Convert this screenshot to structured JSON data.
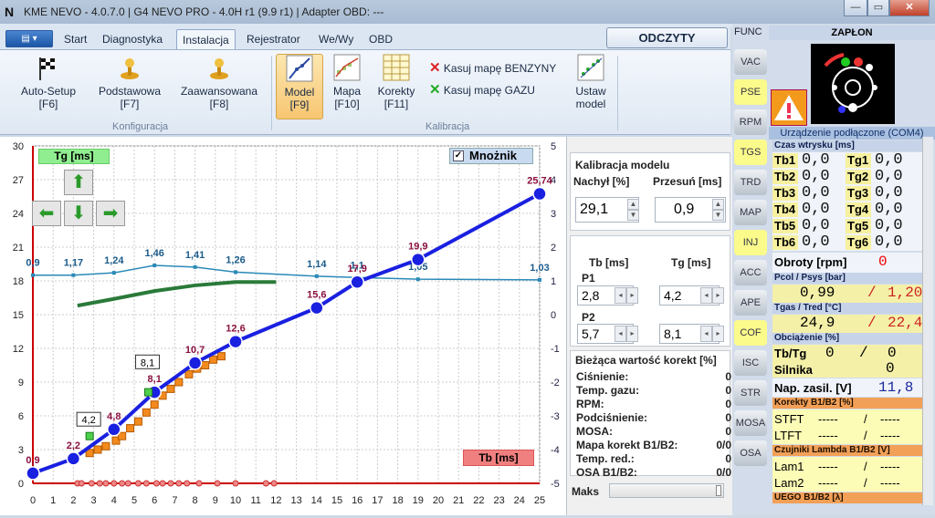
{
  "window": {
    "title": "KME NEVO - 4.0.7.0  |  G4 NEVO PRO - 4.0H r1 (9.9 r1)  |  Adapter OBD: ---",
    "minimize": "—",
    "maximize": "▭",
    "close": "✕"
  },
  "tabs": [
    "Start",
    "Diagnostyka",
    "Instalacja",
    "Rejestrator",
    "We/Wy",
    "OBD"
  ],
  "odczyty": "ODCZYTY",
  "ribbon": {
    "autosetup": "Auto-Setup",
    "autosetup_key": "[F6]",
    "podstawowa": "Podstawowa",
    "podstawowa_key": "[F7]",
    "zaawansowana": "Zaawansowana",
    "zaawansowana_key": "[F8]",
    "konfiguracja": "Konfiguracja",
    "model": "Model",
    "model_key": "[F9]",
    "mapa": "Mapa",
    "mapa_key": "[F10]",
    "korekty": "Korekty",
    "korekty_key": "[F11]",
    "kasuj_benzyny": "Kasuj mapę BENZYNY",
    "kasuj_gazu": "Kasuj mapę GAZU",
    "ustaw": "Ustaw",
    "ustaw2": "model",
    "kalibracja": "Kalibracja"
  },
  "chart_data": {
    "type": "line",
    "xlabel": "Tb [ms]",
    "ylabel": "Tg [ms]",
    "xlim": [
      0,
      25
    ],
    "ylim": [
      0,
      30
    ],
    "ylim_right": [
      -5,
      5
    ],
    "x_ticks": [
      0,
      1,
      2,
      3,
      4,
      5,
      6,
      7,
      8,
      9,
      10,
      11,
      12,
      13,
      14,
      15,
      16,
      17,
      18,
      19,
      20,
      21,
      22,
      23,
      24,
      25
    ],
    "y_ticks": [
      0,
      3,
      6,
      9,
      12,
      15,
      18,
      21,
      24,
      27,
      30
    ],
    "y2_ticks": [
      -5,
      -4,
      -3,
      -2,
      -1,
      0,
      1,
      2,
      3,
      4,
      5
    ],
    "multiplier_label": "Mnożnik",
    "model_series": {
      "x": [
        0,
        2,
        4,
        6,
        8,
        10,
        14,
        16,
        19,
        25
      ],
      "y": [
        0.9,
        2.2,
        4.8,
        8.1,
        10.7,
        12.6,
        15.6,
        17.9,
        19.9,
        25.74
      ],
      "labels": [
        "0,9",
        "2,2",
        "4,8",
        "8,1",
        "10,7",
        "12,6",
        "15,6",
        "17,9",
        "19,9",
        "25,74"
      ]
    },
    "multiplier_series": {
      "x": [
        0,
        2,
        4,
        6,
        8,
        10,
        14,
        16,
        19,
        25
      ],
      "y": [
        1.17,
        1.17,
        1.24,
        1.46,
        1.41,
        1.26,
        1.14,
        1.1,
        1.05,
        1.03
      ],
      "labels": [
        "0,9",
        "1,17",
        "1,24",
        "1,46",
        "1,41",
        "1,26",
        "1,14",
        "1,1",
        "1,05",
        "1,03"
      ]
    },
    "green_band": {
      "x": [
        2.2,
        4,
        6,
        8,
        10,
        12
      ],
      "y": [
        15.8,
        16.4,
        17.1,
        17.6,
        17.9,
        17.9
      ]
    },
    "scatter_orange": {
      "x": [
        2.8,
        3.2,
        3.6,
        4.1,
        4.4,
        4.8,
        5.2,
        5.6,
        6.0,
        6.4,
        6.8,
        7.2,
        7.7,
        8.1,
        8.5,
        8.9,
        9.3
      ],
      "y": [
        2.7,
        3.0,
        3.3,
        3.8,
        4.2,
        4.9,
        5.5,
        6.3,
        7.0,
        7.8,
        8.4,
        9.0,
        9.7,
        10.2,
        10.5,
        11.0,
        11.3
      ]
    },
    "scatter_green": {
      "x": [
        2.8,
        5.7
      ],
      "y": [
        4.2,
        8.1
      ]
    },
    "p_labels": [
      {
        "x": 2.8,
        "y": 4.2,
        "t": "4,2"
      },
      {
        "x": 5.7,
        "y": 9.3,
        "t": "8,1"
      }
    ],
    "zero_markers": [
      2.2,
      2.4,
      2.9,
      3.3,
      3.6,
      4.0,
      4.4,
      4.7,
      5.2,
      5.6,
      6.1,
      6.4,
      6.8,
      7.2,
      7.6,
      8.2,
      9.1,
      10.0,
      11.5,
      11.9
    ]
  },
  "panel": {
    "kalibracja": "Kalibracja modelu",
    "nachyl": "Nachył [%]",
    "przesun": "Przesuń [ms]",
    "nachyl_val": "29,1",
    "przesun_val": "0,9",
    "tb": "Tb [ms]",
    "tg": "Tg [ms]",
    "p1": "P1",
    "p1_tb": "2,8",
    "p1_tg": "4,2",
    "p2": "P2",
    "p2_tb": "5,7",
    "p2_tg": "8,1",
    "korekty_title": "Bieżąca wartość korekt [%]",
    "korekty": [
      {
        "k": "Ciśnienie:",
        "v": "0"
      },
      {
        "k": "Temp. gazu:",
        "v": "0"
      },
      {
        "k": "RPM:",
        "v": "0"
      },
      {
        "k": "Podciśnienie:",
        "v": "0"
      },
      {
        "k": "MOSA:",
        "v": "0"
      },
      {
        "k": "Mapa korekt B1/B2:",
        "v": "0/0"
      },
      {
        "k": "Temp. red.:",
        "v": "0"
      },
      {
        "k": "OSA B1/B2:",
        "v": "0/0"
      }
    ],
    "maks": "Maks"
  },
  "func": {
    "title": "FUNC",
    "items": [
      "VAC",
      "PSE",
      "RPM",
      "TGS",
      "TRD",
      "MAP",
      "INJ",
      "ACC",
      "APE",
      "COF",
      "ISC",
      "STR",
      "MOSA",
      "OSA"
    ]
  },
  "right": {
    "zaplon": "ZAPŁON",
    "status": "Urządzenie podłączone (COM4)",
    "czas": "Czas wtrysku [ms]",
    "rows": [
      {
        "b": "Tb1",
        "bv": "0,0",
        "g": "Tg1",
        "gv": "0,0"
      },
      {
        "b": "Tb2",
        "bv": "0,0",
        "g": "Tg2",
        "gv": "0,0"
      },
      {
        "b": "Tb3",
        "bv": "0,0",
        "g": "Tg3",
        "gv": "0,0"
      },
      {
        "b": "Tb4",
        "bv": "0,0",
        "g": "Tg4",
        "gv": "0,0"
      },
      {
        "b": "Tb5",
        "bv": "0,0",
        "g": "Tg5",
        "gv": "0,0"
      },
      {
        "b": "Tb6",
        "bv": "0,0",
        "g": "Tg6",
        "gv": "0,0"
      }
    ],
    "obroty": "Obroty [rpm]",
    "obroty_val": "0",
    "pcol": "Pcol / Psys [bar]",
    "pcol_val": "0,99",
    "psys_val": "1,20",
    "tgas": "Tgas / Tred [°C]",
    "tgas_val": "24,9",
    "tred_val": "22,4",
    "obciazenie": "Obciążenie [%]",
    "tbtg": "Tb/Tg",
    "tbtg_a": "0",
    "tbtg_b": "0",
    "silnika": "Silnika",
    "silnika_val": "0",
    "nap": "Nap. zasil. [V]",
    "nap_val": "11,8",
    "korekty": "Korekty B1/B2 [%]",
    "stft": "STFT",
    "ltft": "LTFT",
    "dash": "-----",
    "lambda": "Czujniki Lambda B1/B2 [V]",
    "lam1": "Lam1",
    "lam2": "Lam2",
    "uego": "UEGO B1/B2 [λ]"
  }
}
